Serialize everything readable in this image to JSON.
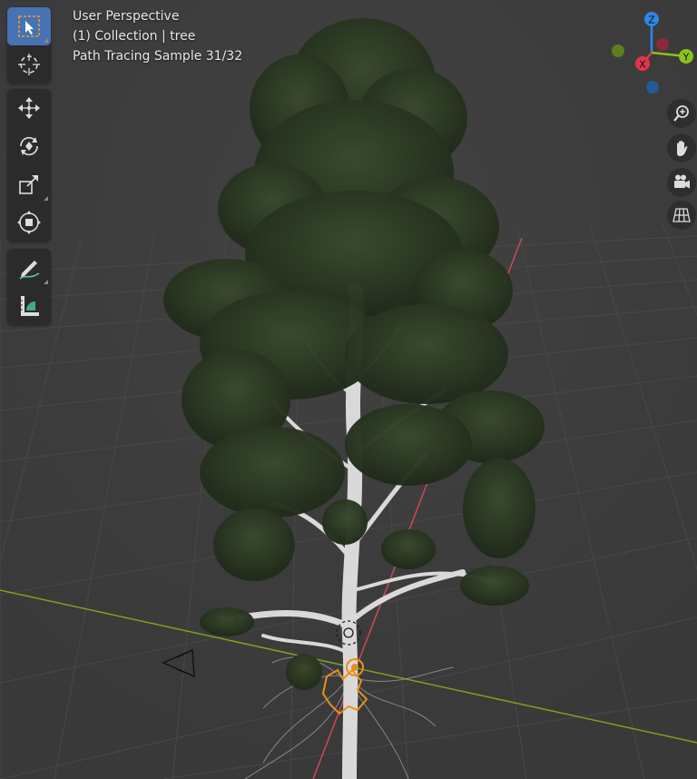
{
  "viewport": {
    "view_name": "User Perspective",
    "collection_info": "(1) Collection | tree",
    "render_status": "Path Tracing Sample 31/32"
  },
  "gizmo": {
    "z_label": "Z",
    "x_label": "X",
    "y_label": "Y",
    "colors": {
      "x": "#e2344e",
      "y": "#8bc21d",
      "z": "#2f86e6"
    }
  },
  "toolbar": {
    "tools": [
      "select-box",
      "cursor",
      "move",
      "rotate",
      "scale",
      "transform",
      "annotate",
      "measure"
    ],
    "active_tool": "select-box"
  },
  "navigation": {
    "buttons": [
      "zoom",
      "pan",
      "camera-view",
      "toggle-orthographic"
    ]
  },
  "scene": {
    "colors": {
      "background": "#3d3d3d",
      "grid": "#4a4a4a",
      "x_axis": "#c94a55",
      "y_axis": "#7fa11f",
      "foliage": "#2c3a24",
      "trunk": "#dcdcdc",
      "selection": "#e8901a"
    }
  }
}
